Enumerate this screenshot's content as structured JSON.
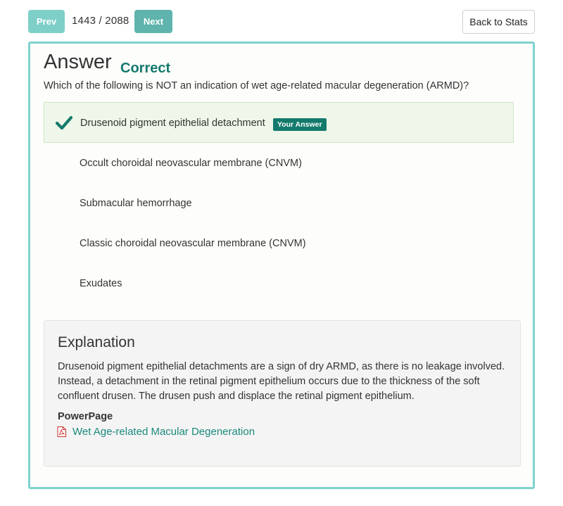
{
  "nav": {
    "prev_label": "Prev",
    "next_label": "Next",
    "counter": "1443 / 2088",
    "back_label": "Back to Stats"
  },
  "answer": {
    "title": "Answer",
    "status": "Correct",
    "question": "Which of the following is NOT an indication of wet age-related macular degeneration (ARMD)?",
    "your_answer_badge": "Your Answer",
    "options": [
      {
        "label": "Drusenoid pigment epithelial detachment",
        "selected": true,
        "icon": "check-icon"
      },
      {
        "label": "Occult choroidal neovascular membrane (CNVM)"
      },
      {
        "label": "Submacular hemorrhage"
      },
      {
        "label": "Classic choroidal neovascular membrane (CNVM)"
      },
      {
        "label": "Exudates"
      }
    ]
  },
  "explanation": {
    "title": "Explanation",
    "body": "Drusenoid pigment epithelial detachments are a sign of dry ARMD, as there is no leakage involved. Instead, a detachment in the retinal pigment epithelium occurs due to the thickness of the soft confluent drusen. The drusen push and displace the retinal pigment epithelium.",
    "powerpage_label": "PowerPage",
    "powerpage_link": "Wet Age-related Macular Degeneration",
    "link_icon": "pdf-icon"
  },
  "colors": {
    "accent": "#137a6c",
    "card_border": "#7dd3cd",
    "link": "#1a8a7c",
    "selected_bg": "#eef7e9",
    "pdf_red": "#c9302c"
  }
}
